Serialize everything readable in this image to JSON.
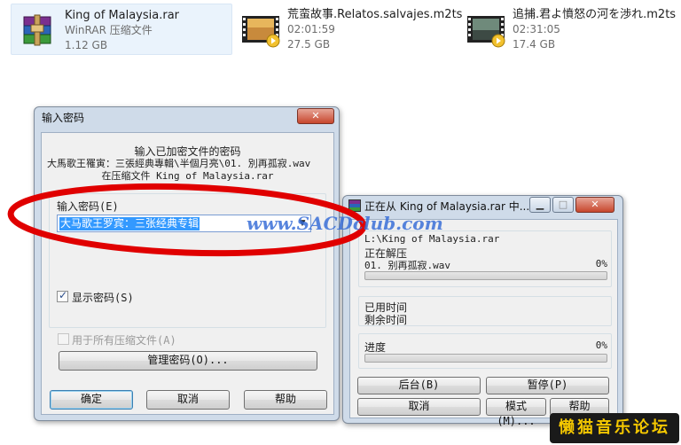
{
  "files": [
    {
      "name": "King of Malaysia.rar",
      "line2": "WinRAR 压缩文件",
      "line3": "1.12 GB",
      "icon": "winrar-archive-icon",
      "selected": true
    },
    {
      "name": "荒蛮故事.Relatos.salvajes.m2ts",
      "line2": "02:01:59",
      "line3": "27.5 GB",
      "icon": "video-file-icon",
      "selected": false
    },
    {
      "name": "追捕.君よ憤怒の河を渉れ.m2ts",
      "line2": "02:31:05",
      "line3": "17.4 GB",
      "icon": "video-file-icon",
      "selected": false
    }
  ],
  "password_dialog": {
    "title": "输入密码",
    "msg_line1": "输入已加密文件的密码",
    "msg_line2": "大馬歌王罹寅：三張經典專輯\\半個月亮\\01. 別再孤寂.wav",
    "msg_line3": "在压缩文件 King of Malaysia.rar",
    "field_label": "输入密码(E)",
    "password_value": "大马歌王罗宾：三张经典专辑",
    "show_password_label": "显示密码(S)",
    "show_password_checked": true,
    "all_archives_label": "用于所有压缩文件(A)",
    "all_archives_checked": false,
    "manage_button": "管理密码(O)...",
    "ok_button": "确定",
    "cancel_button": "取消",
    "help_button": "帮助"
  },
  "extract_dialog": {
    "title": "正在从 King of Malaysia.rar 中...",
    "path": "L:\\King of Malaysia.rar",
    "action": "正在解压",
    "current_file": "01. 别再孤寂.wav",
    "file_percent": "0%",
    "file_progress": 0,
    "elapsed_label": "已用时间",
    "remaining_label": "剩余时间",
    "progress_label": "进度",
    "total_percent": "0%",
    "total_progress": 0,
    "background_button": "后台(B)",
    "pause_button": "暂停(P)",
    "cancel_button": "取消",
    "mode_button": "模式(M)...",
    "help_button": "帮助"
  },
  "watermark": "www.SACDclub.com",
  "forum_badge": "懒猫音乐论坛",
  "colors": {
    "annotation_red": "#e00000",
    "watermark_blue": "#3a6fd8",
    "selection_blue": "#3399ff",
    "badge_bg": "#1a1a1a",
    "badge_text": "#f5c800"
  }
}
